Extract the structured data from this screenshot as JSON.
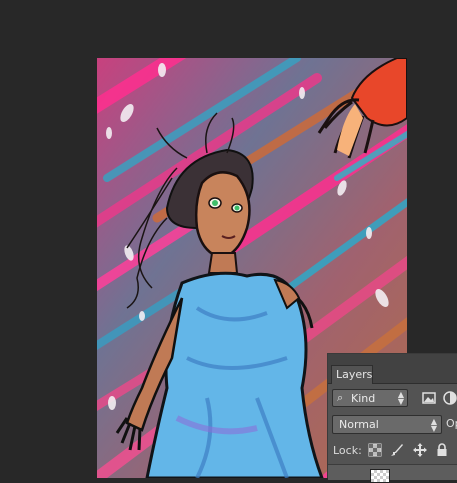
{
  "layers_panel": {
    "tab_label": "Layers",
    "filter": {
      "selected": "Kind",
      "icons": [
        "image-filter-icon",
        "adjustment-filter-icon"
      ]
    },
    "blend_mode": "Normal",
    "opacity_label_partial": "Op",
    "lock_label": "Lock:",
    "lock_icons": [
      "lock-transparent-pixels-icon",
      "lock-image-pixels-icon",
      "lock-position-icon",
      "lock-all-icon"
    ]
  },
  "canvas": {
    "content": "digital painting of a girl in a blue dress reaching up toward a red hand"
  },
  "colors": {
    "workspace": "#282828",
    "panel": "#535353",
    "panel_header": "#424242"
  }
}
